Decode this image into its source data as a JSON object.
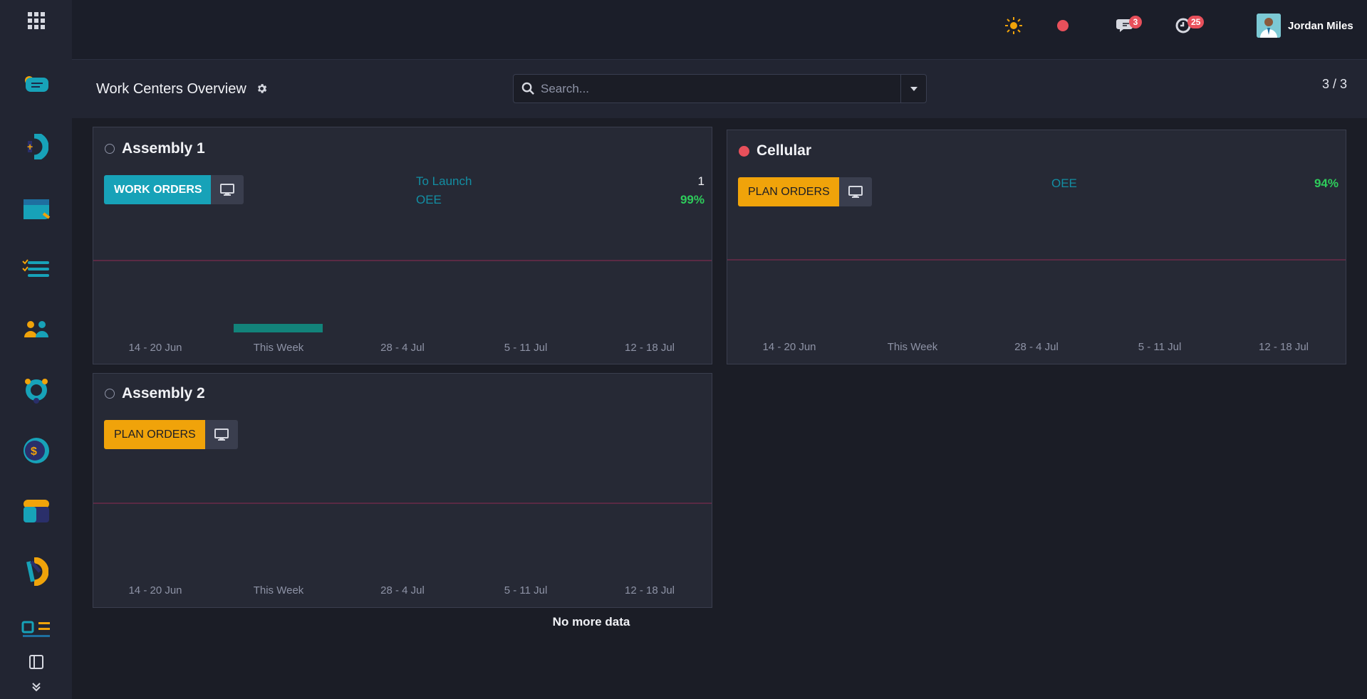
{
  "topbar": {
    "user_name": "Jordan Miles",
    "messages_count": "3",
    "activities_count": "25"
  },
  "control": {
    "title": "Work Centers Overview",
    "search_placeholder": "Search...",
    "pager": "3 / 3"
  },
  "workcenters": [
    {
      "name": "Assembly 1",
      "status": "none",
      "button_label": "WORK ORDERS",
      "stats": [
        {
          "label": "To Launch",
          "value": "1"
        },
        {
          "label": "OEE",
          "value": "99%"
        }
      ],
      "chart_ticks": [
        "14 - 20 Jun",
        "This Week",
        "28 - 4 Jul",
        "5 - 11 Jul",
        "12 - 18 Jul"
      ]
    },
    {
      "name": "Cellular",
      "status": "red",
      "button_label": "PLAN ORDERS",
      "stats": [
        {
          "label": "OEE",
          "value": "94%"
        }
      ],
      "chart_ticks": [
        "14 - 20 Jun",
        "This Week",
        "28 - 4 Jul",
        "5 - 11 Jul",
        "12 - 18 Jul"
      ]
    },
    {
      "name": "Assembly 2",
      "status": "none",
      "button_label": "PLAN ORDERS",
      "stats": [],
      "chart_ticks": [
        "14 - 20 Jun",
        "This Week",
        "28 - 4 Jul",
        "5 - 11 Jul",
        "12 - 18 Jul"
      ]
    }
  ],
  "footer_text": "No more data",
  "colors": {
    "accent_teal": "#17a2b8",
    "accent_orange": "#f0a30a",
    "ok_green": "#2ecc5b",
    "alert_red": "#e8505b"
  }
}
